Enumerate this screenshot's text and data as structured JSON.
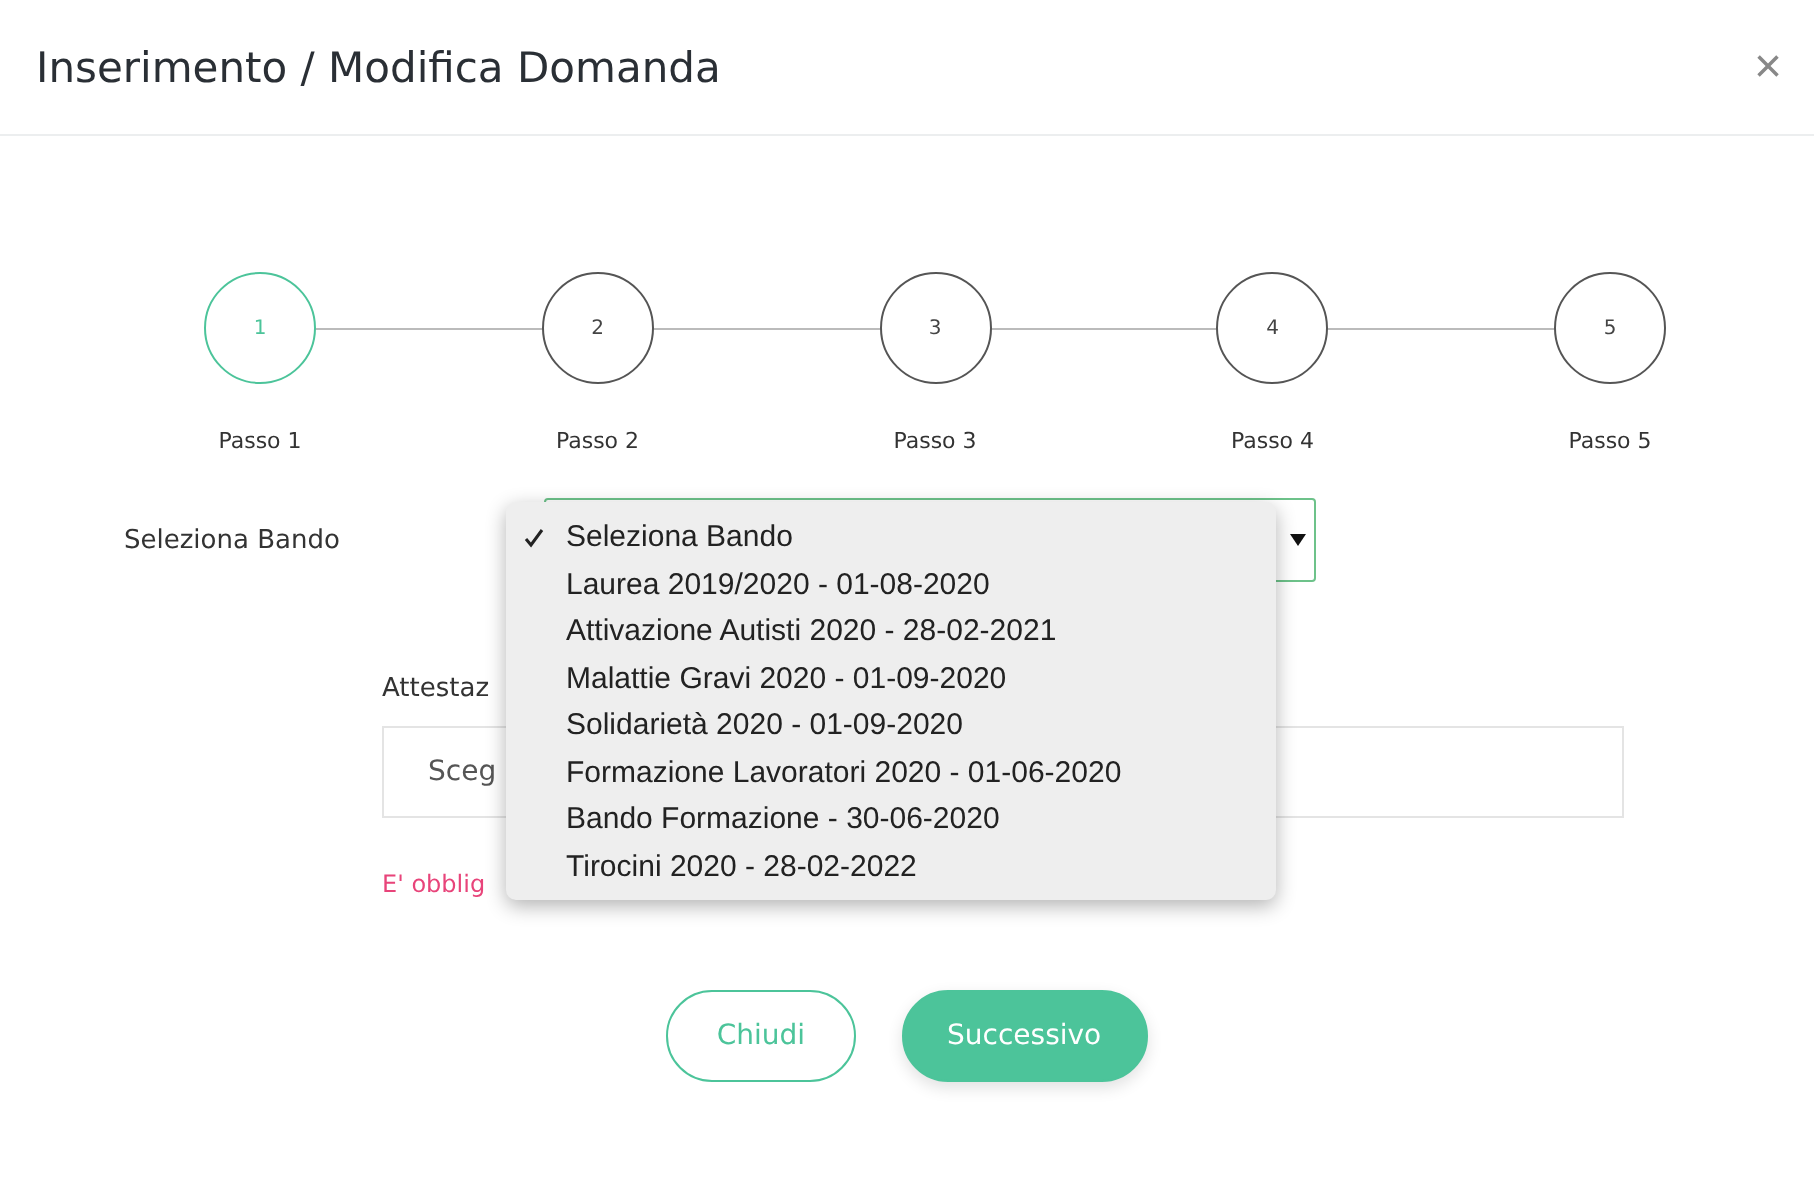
{
  "dialog": {
    "title": "Inserimento / Modifica Domanda",
    "close": "×"
  },
  "steps": [
    {
      "number": "1",
      "label": "Passo 1",
      "selected": true
    },
    {
      "number": "2",
      "label": "Passo 2",
      "selected": false
    },
    {
      "number": "3",
      "label": "Passo 3",
      "selected": false
    },
    {
      "number": "4",
      "label": "Passo 4",
      "selected": false
    },
    {
      "number": "5",
      "label": "Passo 5",
      "selected": false
    }
  ],
  "bando": {
    "label": "Seleziona Bando",
    "expanded": true,
    "options": [
      {
        "label": "Seleziona Bando",
        "selected": true
      },
      {
        "label": "Laurea 2019/2020 - 01-08-2020",
        "selected": false
      },
      {
        "label": "Attivazione Autisti 2020 - 28-02-2021",
        "selected": false
      },
      {
        "label": "Malattie Gravi 2020 - 01-09-2020",
        "selected": false
      },
      {
        "label": "Solidarietà 2020 - 01-09-2020",
        "selected": false
      },
      {
        "label": "Formazione Lavoratori 2020 - 01-06-2020",
        "selected": false
      },
      {
        "label": "Bando Formazione - 30-06-2020",
        "selected": false
      },
      {
        "label": "Tirocini 2020 - 28-02-2022",
        "selected": false
      }
    ]
  },
  "attestazione": {
    "label": "Attestaz",
    "button": "Sceg",
    "error": "E' obblig"
  },
  "buttons": [
    {
      "kind": "outline",
      "label": "Chiudi"
    },
    {
      "kind": "primary",
      "label": "Successivo"
    }
  ]
}
